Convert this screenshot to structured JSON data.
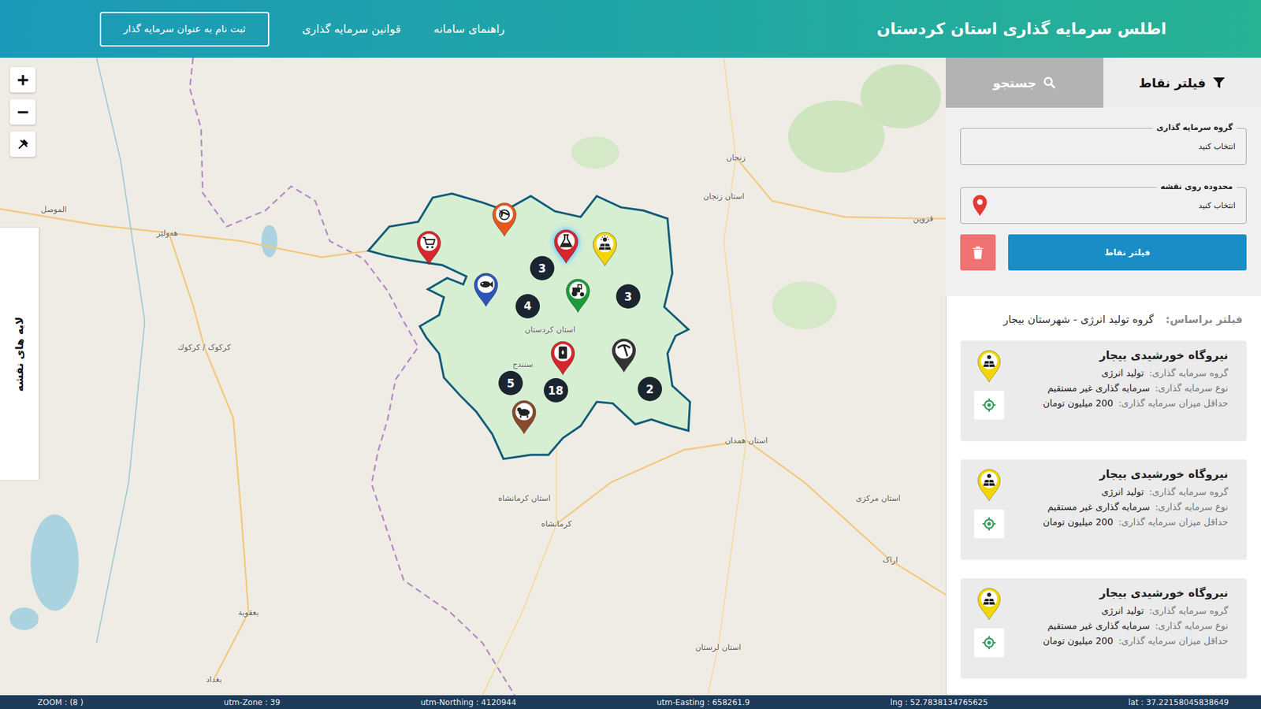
{
  "header": {
    "title": "اطلس سرمایه گذاری استان کردستان",
    "links": [
      "راهنمای سامانه",
      "قوانین سرمایه گذاری"
    ],
    "register_button": "ثبت نام به عنوان سرمایه گذار"
  },
  "map": {
    "layers_tab": "لایه های نقشه",
    "labels": [
      "سنندج",
      "استان کردستان",
      "کرمانشاه",
      "استان کرمانشاه",
      "زنجان",
      "استان زنجان",
      "استان همدان",
      "کرکوک / كركوك",
      "هەولێر",
      "الموصل",
      "بغداد",
      "بعقوبة",
      "استان مرکزی",
      "اراک",
      "استان لرستان",
      "قزوین"
    ],
    "pins": [
      {
        "kind": "commerce",
        "color": "#d7262d",
        "selected": false
      },
      {
        "kind": "tourism",
        "color": "#e8571e",
        "selected": false
      },
      {
        "kind": "fishery",
        "color": "#2d54b8",
        "selected": false
      },
      {
        "kind": "chemical",
        "color": "#d7262d",
        "selected": true
      },
      {
        "kind": "energy",
        "color": "#f2d600",
        "selected": false
      },
      {
        "kind": "agriculture",
        "color": "#1e9a3a",
        "selected": false
      },
      {
        "kind": "oil",
        "color": "#d7262d",
        "selected": false
      },
      {
        "kind": "mining",
        "color": "#333333",
        "selected": false
      },
      {
        "kind": "livestock",
        "color": "#8a4a2c",
        "selected": false
      }
    ],
    "clusters": [
      "3",
      "4",
      "3",
      "5",
      "18",
      "2"
    ]
  },
  "panel": {
    "tabs": [
      {
        "label": "فیلتر نقاط",
        "selected": true
      },
      {
        "label": "جستجو",
        "selected": false
      }
    ],
    "fields": [
      {
        "label": "گروه سرمایه گذاری",
        "placeholder": "انتخاب کنید",
        "kind": "select"
      },
      {
        "label": "محدوده روی نقشه",
        "placeholder": "انتخاب کنید",
        "kind": "map"
      }
    ],
    "filter_button": "فیلتر نقاط",
    "filter_by": {
      "label": "فیلتر براساس:",
      "value": "گروه تولید انرژی - شهرستان بیجار"
    },
    "results": [
      {
        "title": "نیروگاه خورشیدی بیجار",
        "rows": [
          {
            "label": "گروه سرمایه گذاری:",
            "value": "تولید انرژی"
          },
          {
            "label": "نوع سرمایه گذاری:",
            "value": "سرمایه گذاری غیر مستقیم"
          },
          {
            "label": "حداقل میزان سرمایه گذاری:",
            "value": "200 میلیون تومان"
          }
        ]
      },
      {
        "title": "نیروگاه خورشیدی بیجار",
        "rows": [
          {
            "label": "گروه سرمایه گذاری:",
            "value": "تولید انرژی"
          },
          {
            "label": "نوع سرمایه گذاری:",
            "value": "سرمایه گذاری غیر مستقیم"
          },
          {
            "label": "حداقل میزان سرمایه گذاری:",
            "value": "200 میلیون تومان"
          }
        ]
      },
      {
        "title": "نیروگاه خورشیدی بیجار",
        "rows": [
          {
            "label": "گروه سرمایه گذاری:",
            "value": "تولید انرژی"
          },
          {
            "label": "نوع سرمایه گذاری:",
            "value": "سرمایه گذاری غیر مستقیم"
          },
          {
            "label": "حداقل میزان سرمایه گذاری:",
            "value": "200 میلیون تومان"
          }
        ]
      }
    ]
  },
  "status_bar": [
    "ZOOM : (8 )",
    "utm-Zone : 39",
    "utm-Northing : 4120944",
    "utm-Easting : 658261.9",
    "lng : 52.7838134765625",
    "lat : 37.22158045838649"
  ]
}
